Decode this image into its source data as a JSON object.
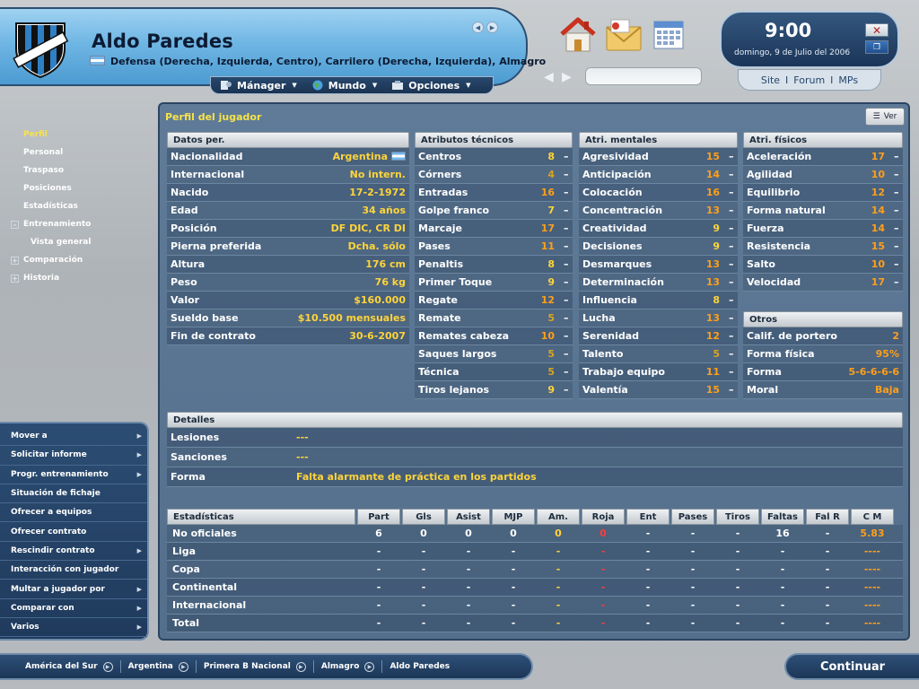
{
  "header": {
    "player_name": "Aldo Paredes",
    "player_subtitle": "Defensa (Derecha, Izquierda, Centro), Carrilero (Derecha, Izquierda), Almagro",
    "club_badge_text": "ALMAGRO",
    "menu": [
      {
        "label": "Mánager",
        "icon": "manager-icon"
      },
      {
        "label": "Mundo",
        "icon": "globe-icon"
      },
      {
        "label": "Opciones",
        "icon": "options-icon"
      }
    ]
  },
  "top_icons": [
    "home-icon",
    "mail-icon",
    "calendar-icon"
  ],
  "clock": {
    "time": "9:00",
    "date": "domingo, 9 de Julio del 2006"
  },
  "site_links": [
    "Site",
    "Forum",
    "MPs"
  ],
  "sidebar": {
    "items": [
      {
        "label": "Perfil",
        "active": true
      },
      {
        "label": "Personal"
      },
      {
        "label": "Traspaso"
      },
      {
        "label": "Posiciones"
      },
      {
        "label": "Estadísticas"
      },
      {
        "label": "Entrenamiento",
        "toggle": "-"
      },
      {
        "label": "Vista general",
        "sub": true
      },
      {
        "label": "Comparación",
        "toggle": "+"
      },
      {
        "label": "Historia",
        "toggle": "+"
      }
    ]
  },
  "actions": [
    "Mover a",
    "Solicitar informe",
    "Progr. entrenamiento",
    "Situación de fichaje",
    "Ofrecer a equipos",
    "Ofrecer contrato",
    "Rescindir contrato",
    "Interacción con jugador",
    "Multar a jugador por",
    "Comparar con",
    "Varios"
  ],
  "actions_with_arrow": [
    true,
    true,
    true,
    false,
    false,
    false,
    true,
    false,
    true,
    true,
    true
  ],
  "panel": {
    "title": "Perfil del jugador",
    "ver_label": "Ver"
  },
  "personal": {
    "title": "Datos per.",
    "rows": [
      [
        "Nacionalidad",
        "Argentina"
      ],
      [
        "Internacional",
        "No intern."
      ],
      [
        "Nacido",
        "17-2-1972"
      ],
      [
        "Edad",
        "34 años"
      ],
      [
        "Posición",
        "DF DIC, CR DI"
      ],
      [
        "Pierna preferida",
        "Dcha. sólo"
      ],
      [
        "Altura",
        "176 cm"
      ],
      [
        "Peso",
        "76 kg"
      ],
      [
        "Valor",
        "$160.000"
      ],
      [
        "Sueldo base",
        "$10.500 mensuales"
      ],
      [
        "Fin de contrato",
        "30-6-2007"
      ]
    ]
  },
  "technical": {
    "title": "Atributos técnicos",
    "rows": [
      [
        "Centros",
        "8"
      ],
      [
        "Córners",
        "4"
      ],
      [
        "Entradas",
        "16"
      ],
      [
        "Golpe franco",
        "7"
      ],
      [
        "Marcaje",
        "17"
      ],
      [
        "Pases",
        "11"
      ],
      [
        "Penaltis",
        "8"
      ],
      [
        "Primer Toque",
        "9"
      ],
      [
        "Regate",
        "12"
      ],
      [
        "Remate",
        "5"
      ],
      [
        "Remates cabeza",
        "10"
      ],
      [
        "Saques largos",
        "5"
      ],
      [
        "Técnica",
        "5"
      ],
      [
        "Tiros lejanos",
        "9"
      ]
    ]
  },
  "mental": {
    "title": "Atri. mentales",
    "rows": [
      [
        "Agresividad",
        "15"
      ],
      [
        "Anticipación",
        "14"
      ],
      [
        "Colocación",
        "16"
      ],
      [
        "Concentración",
        "13"
      ],
      [
        "Creatividad",
        "9"
      ],
      [
        "Decisiones",
        "9"
      ],
      [
        "Desmarques",
        "13"
      ],
      [
        "Determinación",
        "13"
      ],
      [
        "Influencia",
        "8"
      ],
      [
        "Lucha",
        "13"
      ],
      [
        "Serenidad",
        "12"
      ],
      [
        "Talento",
        "5"
      ],
      [
        "Trabajo equipo",
        "11"
      ],
      [
        "Valentía",
        "15"
      ]
    ]
  },
  "physical": {
    "title": "Atri. físicos",
    "rows": [
      [
        "Aceleración",
        "17"
      ],
      [
        "Agilidad",
        "10"
      ],
      [
        "Equilibrio",
        "12"
      ],
      [
        "Forma natural",
        "14"
      ],
      [
        "Fuerza",
        "14"
      ],
      [
        "Resistencia",
        "15"
      ],
      [
        "Salto",
        "10"
      ],
      [
        "Velocidad",
        "17"
      ]
    ]
  },
  "others": {
    "title": "Otros",
    "rows": [
      [
        "Calif. de portero",
        "2"
      ],
      [
        "Forma física",
        "95%"
      ],
      [
        "Forma",
        "5-6-6-6-6"
      ],
      [
        "Moral",
        "Baja"
      ]
    ]
  },
  "details": {
    "title": "Detalles",
    "rows": [
      [
        "Lesiones",
        "---"
      ],
      [
        "Sanciones",
        "---"
      ],
      [
        "Forma",
        "Falta alarmante de práctica en los partidos"
      ]
    ]
  },
  "stats": {
    "headers": [
      "Estadísticas",
      "Part",
      "Gls",
      "Asist",
      "MJP",
      "Am.",
      "Roja",
      "Ent",
      "Pases",
      "Tiros",
      "Faltas",
      "Fal R",
      "C M"
    ],
    "rows": [
      [
        "No oficiales",
        "6",
        "0",
        "0",
        "0",
        "0",
        "0",
        "-",
        "-",
        "-",
        "16",
        "-",
        "5.83"
      ],
      [
        "Liga",
        "-",
        "-",
        "-",
        "-",
        "-",
        "-",
        "-",
        "-",
        "-",
        "-",
        "-",
        "----"
      ],
      [
        "Copa",
        "-",
        "-",
        "-",
        "-",
        "-",
        "-",
        "-",
        "-",
        "-",
        "-",
        "-",
        "----"
      ],
      [
        "Continental",
        "-",
        "-",
        "-",
        "-",
        "-",
        "-",
        "-",
        "-",
        "-",
        "-",
        "-",
        "----"
      ],
      [
        "Internacional",
        "-",
        "-",
        "-",
        "-",
        "-",
        "-",
        "-",
        "-",
        "-",
        "-",
        "-",
        "----"
      ],
      [
        "Total",
        "-",
        "-",
        "-",
        "-",
        "-",
        "-",
        "-",
        "-",
        "-",
        "-",
        "-",
        "----"
      ]
    ]
  },
  "breadcrumb": [
    "América del Sur",
    "Argentina",
    "Primera B Nacional",
    "Almagro",
    "Aldo Paredes"
  ],
  "continue_label": "Continuar",
  "colors": {
    "accent_yellow": "#ffd43a",
    "accent_orange": "#ff9f1a",
    "header_blue": "#6fb6e4",
    "panel_blue": "#5f7b98"
  }
}
